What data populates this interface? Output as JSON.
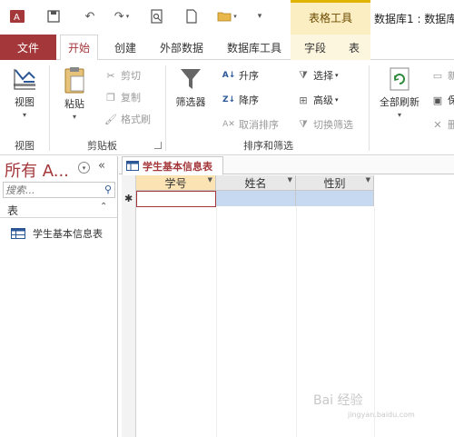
{
  "titlebar": {
    "context_tab": "表格工具",
    "db_title": "数据库1 : 数据库-"
  },
  "tabs": {
    "file": "文件",
    "home": "开始",
    "create": "创建",
    "external": "外部数据",
    "dbtools": "数据库工具",
    "fields": "字段",
    "table": "表"
  },
  "ribbon": {
    "view": {
      "label": "视图",
      "group": "视图"
    },
    "clipboard": {
      "paste": "粘贴",
      "cut": "剪切",
      "copy": "复制",
      "format_painter": "格式刷",
      "group": "剪贴板"
    },
    "sortfilter": {
      "filter": "筛选器",
      "ascending": "升序",
      "descending": "降序",
      "remove_sort": "取消排序",
      "selection": "选择",
      "advanced": "高级",
      "toggle_filter": "切换筛选",
      "group": "排序和筛选"
    },
    "records": {
      "refresh_all": "全部刷新",
      "new": "新",
      "save": "保",
      "delete": "删"
    }
  },
  "navpane": {
    "title": "所有 A...",
    "search_placeholder": "搜索...",
    "section": "表",
    "items": [
      {
        "label": "学生基本信息表"
      }
    ]
  },
  "document": {
    "tab_label": "学生基本信息表",
    "columns": [
      {
        "label": "学号"
      },
      {
        "label": "姓名"
      },
      {
        "label": "性别"
      }
    ]
  },
  "watermark": {
    "text": "Bai 经验",
    "sub": "jingyan.baidu.com"
  },
  "colors": {
    "accent": "#a4373a",
    "context_tab": "#fbeec2",
    "new_row": "#c6d9f1"
  }
}
